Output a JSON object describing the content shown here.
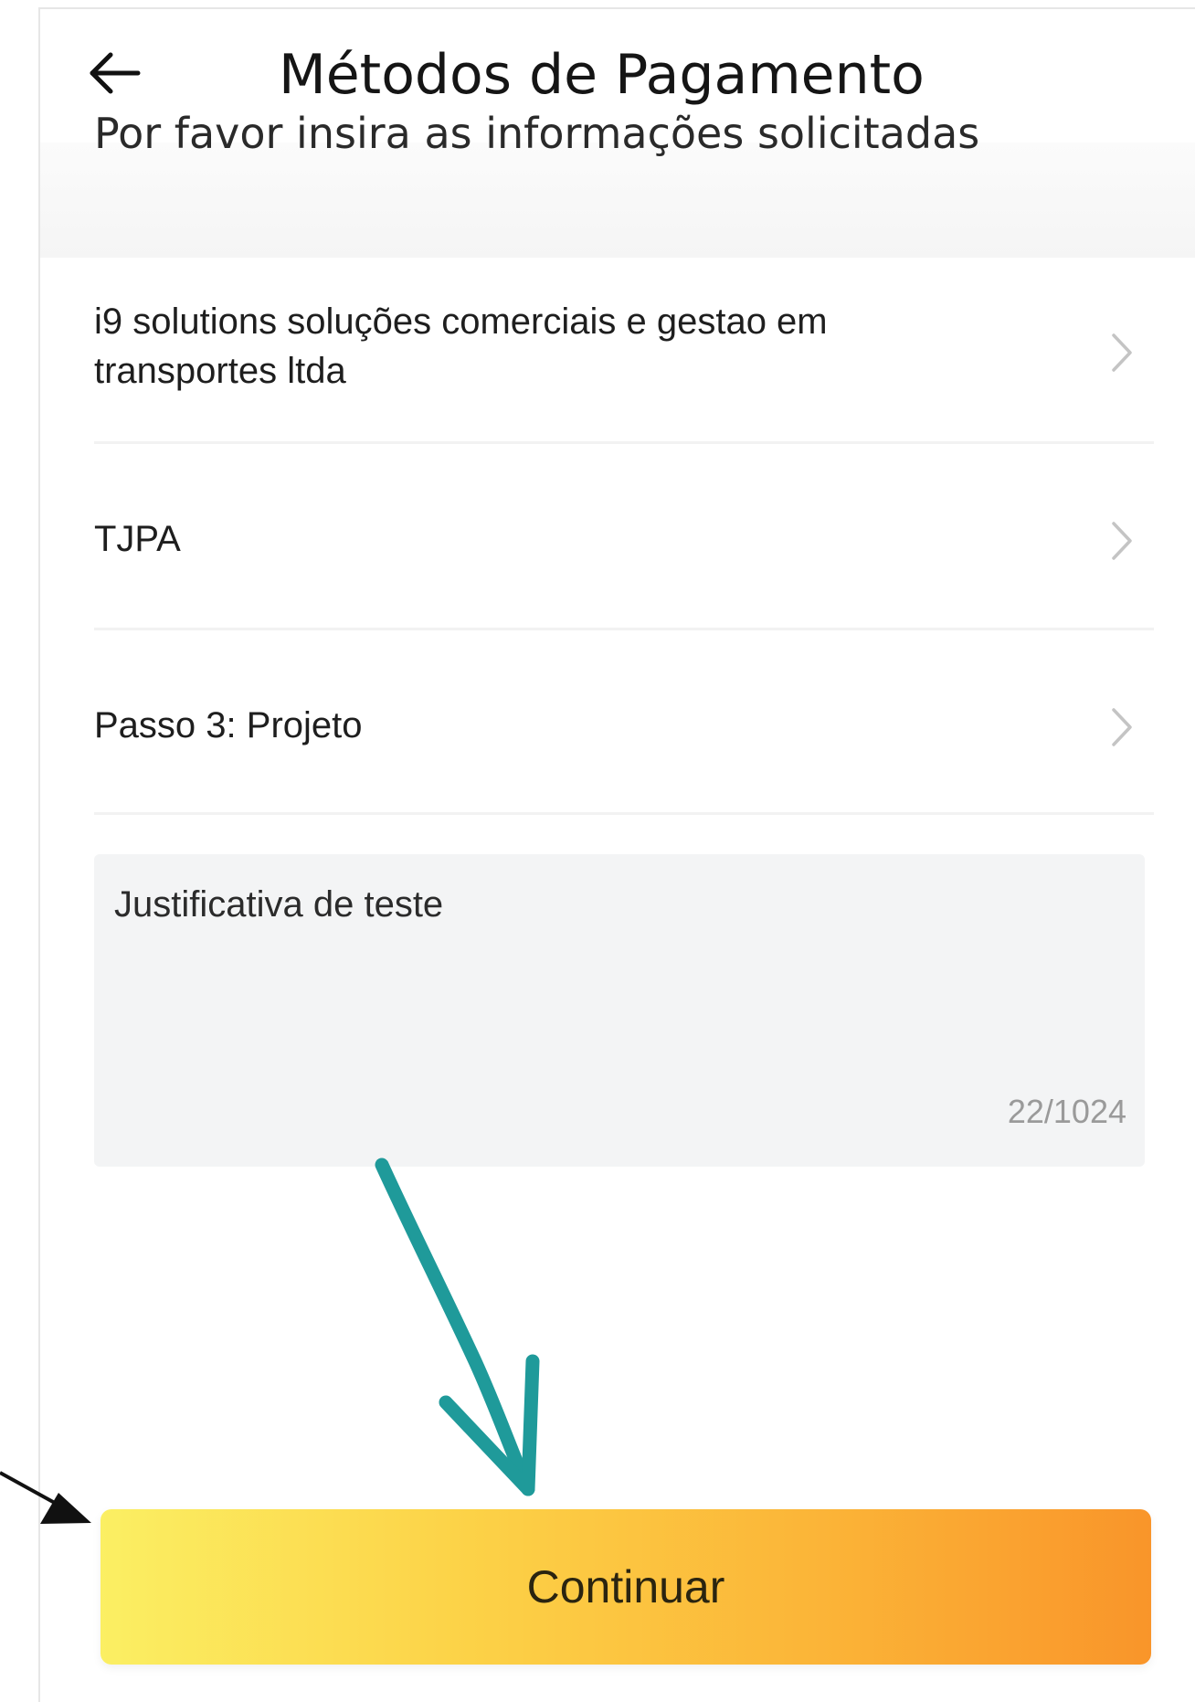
{
  "header": {
    "title": "Métodos de Pagamento",
    "subtitle": "Por favor insira as informações solicitadas",
    "back_icon": "arrow-left-icon"
  },
  "list": {
    "items": [
      {
        "label": "i9 solutions soluções comerciais e gestao em transportes ltda",
        "icon": "chevron-right-icon"
      },
      {
        "label": "TJPA",
        "icon": "chevron-right-icon"
      },
      {
        "label": "Passo 3: Projeto",
        "icon": "chevron-right-icon"
      }
    ]
  },
  "justification": {
    "value": "Justificativa de teste",
    "counter": "22/1024"
  },
  "footer": {
    "continue_label": "Continuar"
  },
  "colors": {
    "button_gradient_start": "#fbef63",
    "button_gradient_end": "#f9952a",
    "annotation_teal": "#1f9a9a",
    "annotation_black": "#111111"
  }
}
